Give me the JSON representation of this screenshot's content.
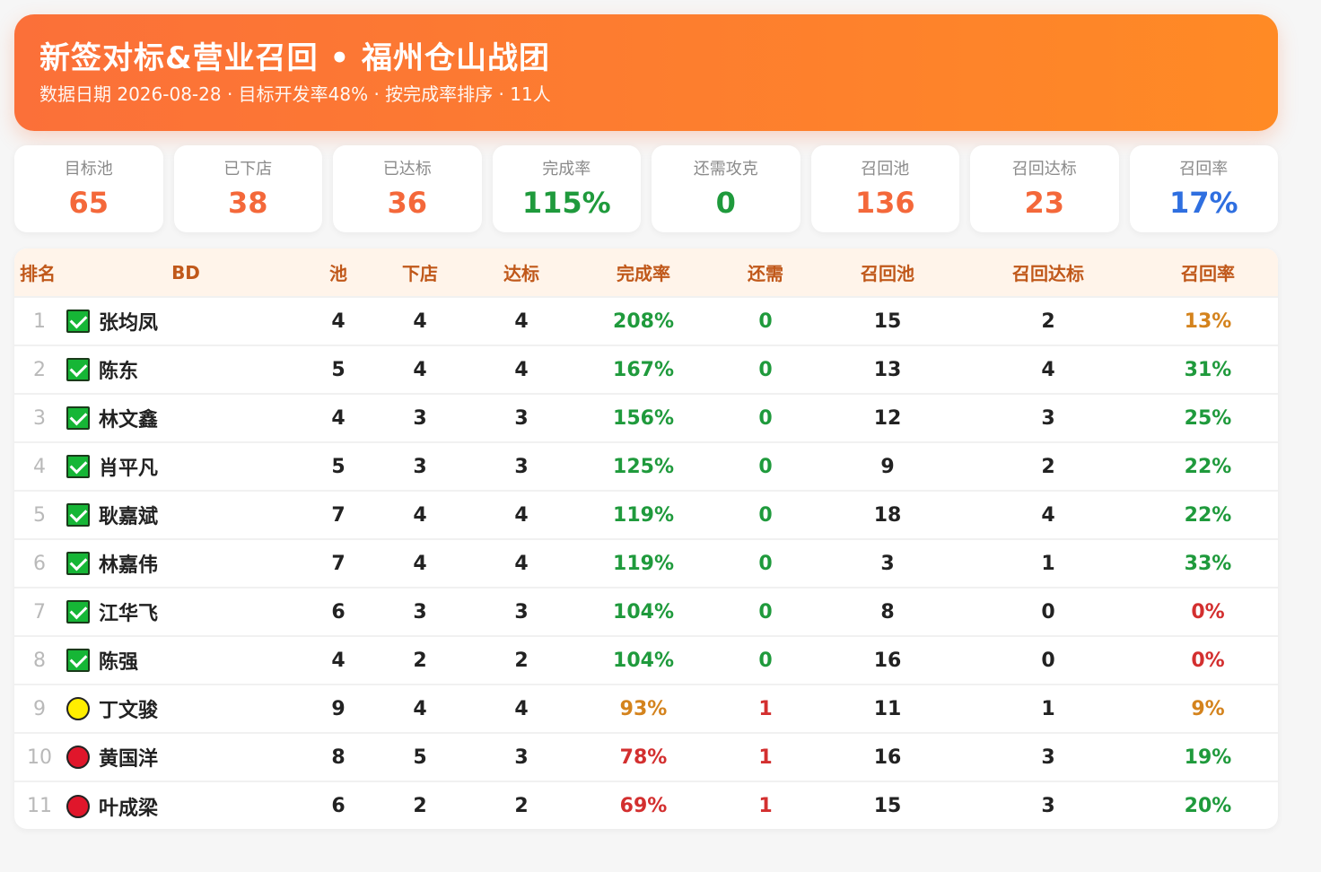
{
  "header": {
    "title": "新签对标&营业召回 • 福州仓山战团",
    "subtitle": "数据日期 2026-08-28 · 目标开发率48% · 按完成率排序 · 11人"
  },
  "colors": {
    "orange": "#f4683a",
    "green": "#1f9a3c",
    "blue": "#2f6fe0",
    "amber": "#d4831d",
    "red": "#d32f2f"
  },
  "cards": [
    {
      "label": "目标池",
      "value": "65",
      "color": "orange"
    },
    {
      "label": "已下店",
      "value": "38",
      "color": "orange"
    },
    {
      "label": "已达标",
      "value": "36",
      "color": "orange"
    },
    {
      "label": "完成率",
      "value": "115%",
      "color": "green"
    },
    {
      "label": "还需攻克",
      "value": "0",
      "color": "green"
    },
    {
      "label": "召回池",
      "value": "136",
      "color": "orange"
    },
    {
      "label": "召回达标",
      "value": "23",
      "color": "orange"
    },
    {
      "label": "召回率",
      "value": "17%",
      "color": "blue"
    }
  ],
  "table": {
    "headers": [
      "排名",
      "BD",
      "池",
      "下店",
      "达标",
      "完成率",
      "还需",
      "召回池",
      "召回达标",
      "召回率"
    ],
    "rows": [
      {
        "rank": "1",
        "status": "check-icon",
        "name": "张均凤",
        "pool": "4",
        "visited": "4",
        "met": "4",
        "rate": "208%",
        "rate_color": "green",
        "need": "0",
        "need_color": "green",
        "recall_pool": "15",
        "recall_met": "2",
        "recall_rate": "13%",
        "recall_color": "amber"
      },
      {
        "rank": "2",
        "status": "check-icon",
        "name": "陈东",
        "pool": "5",
        "visited": "4",
        "met": "4",
        "rate": "167%",
        "rate_color": "green",
        "need": "0",
        "need_color": "green",
        "recall_pool": "13",
        "recall_met": "4",
        "recall_rate": "31%",
        "recall_color": "green"
      },
      {
        "rank": "3",
        "status": "check-icon",
        "name": "林文鑫",
        "pool": "4",
        "visited": "3",
        "met": "3",
        "rate": "156%",
        "rate_color": "green",
        "need": "0",
        "need_color": "green",
        "recall_pool": "12",
        "recall_met": "3",
        "recall_rate": "25%",
        "recall_color": "green"
      },
      {
        "rank": "4",
        "status": "check-icon",
        "name": "肖平凡",
        "pool": "5",
        "visited": "3",
        "met": "3",
        "rate": "125%",
        "rate_color": "green",
        "need": "0",
        "need_color": "green",
        "recall_pool": "9",
        "recall_met": "2",
        "recall_rate": "22%",
        "recall_color": "green"
      },
      {
        "rank": "5",
        "status": "check-icon",
        "name": "耿嘉斌",
        "pool": "7",
        "visited": "4",
        "met": "4",
        "rate": "119%",
        "rate_color": "green",
        "need": "0",
        "need_color": "green",
        "recall_pool": "18",
        "recall_met": "4",
        "recall_rate": "22%",
        "recall_color": "green"
      },
      {
        "rank": "6",
        "status": "check-icon",
        "name": "林嘉伟",
        "pool": "7",
        "visited": "4",
        "met": "4",
        "rate": "119%",
        "rate_color": "green",
        "need": "0",
        "need_color": "green",
        "recall_pool": "3",
        "recall_met": "1",
        "recall_rate": "33%",
        "recall_color": "green"
      },
      {
        "rank": "7",
        "status": "check-icon",
        "name": "江华飞",
        "pool": "6",
        "visited": "3",
        "met": "3",
        "rate": "104%",
        "rate_color": "green",
        "need": "0",
        "need_color": "green",
        "recall_pool": "8",
        "recall_met": "0",
        "recall_rate": "0%",
        "recall_color": "red"
      },
      {
        "rank": "8",
        "status": "check-icon",
        "name": "陈强",
        "pool": "4",
        "visited": "2",
        "met": "2",
        "rate": "104%",
        "rate_color": "green",
        "need": "0",
        "need_color": "green",
        "recall_pool": "16",
        "recall_met": "0",
        "recall_rate": "0%",
        "recall_color": "red"
      },
      {
        "rank": "9",
        "status": "yellow-circle-icon",
        "name": "丁文骏",
        "pool": "9",
        "visited": "4",
        "met": "4",
        "rate": "93%",
        "rate_color": "amber",
        "need": "1",
        "need_color": "red",
        "recall_pool": "11",
        "recall_met": "1",
        "recall_rate": "9%",
        "recall_color": "amber"
      },
      {
        "rank": "10",
        "status": "red-circle-icon",
        "name": "黄国洋",
        "pool": "8",
        "visited": "5",
        "met": "3",
        "rate": "78%",
        "rate_color": "red",
        "need": "1",
        "need_color": "red",
        "recall_pool": "16",
        "recall_met": "3",
        "recall_rate": "19%",
        "recall_color": "green"
      },
      {
        "rank": "11",
        "status": "red-circle-icon",
        "name": "叶成梁",
        "pool": "6",
        "visited": "2",
        "met": "2",
        "rate": "69%",
        "rate_color": "red",
        "need": "1",
        "need_color": "red",
        "recall_pool": "15",
        "recall_met": "3",
        "recall_rate": "20%",
        "recall_color": "green"
      }
    ]
  }
}
